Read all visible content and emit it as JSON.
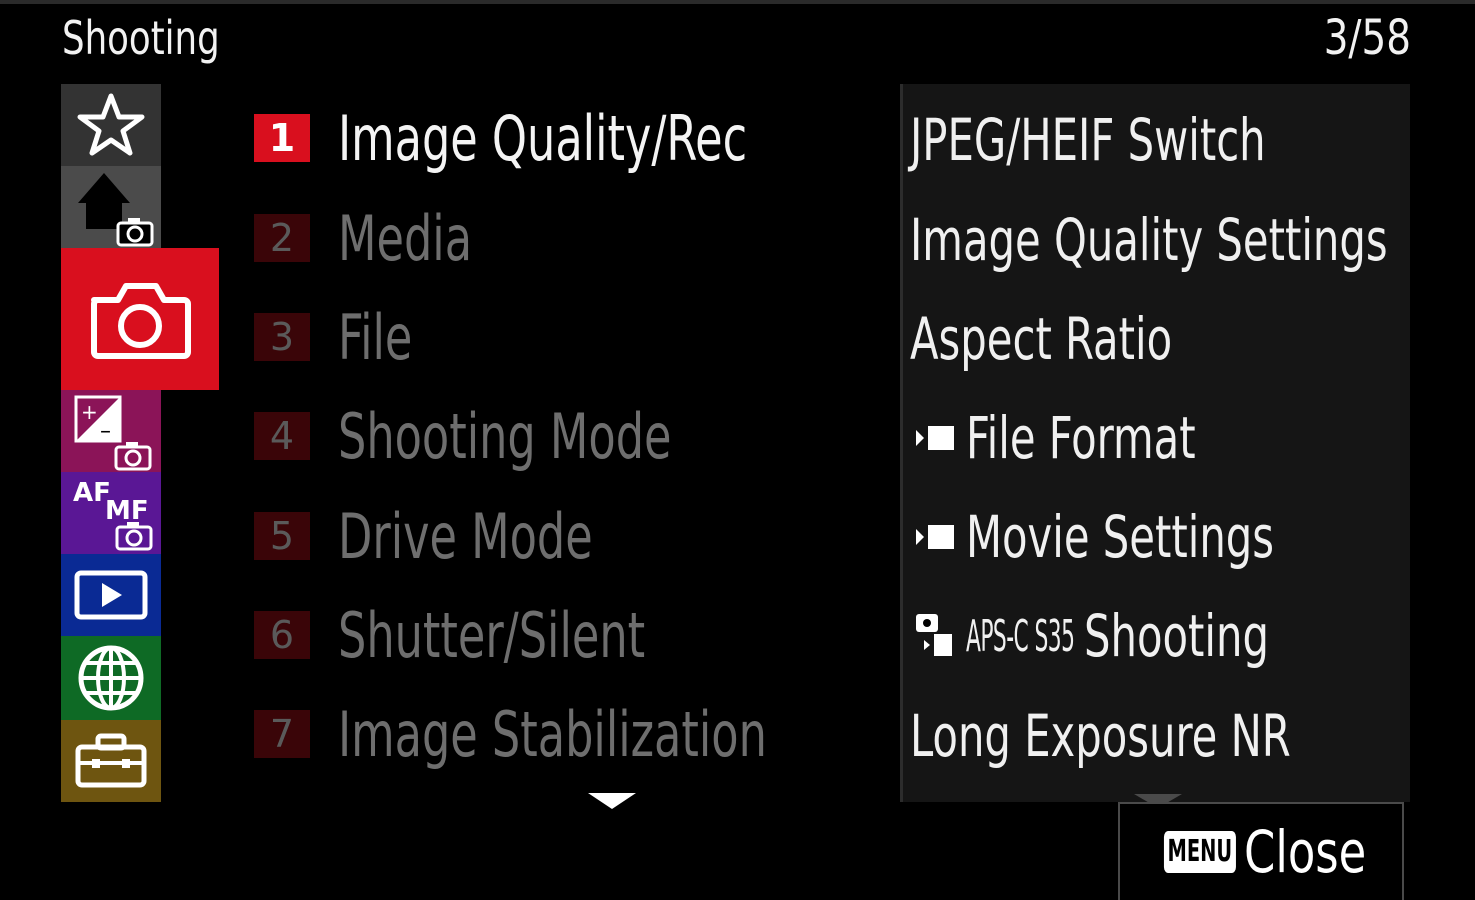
{
  "header": {
    "title": "Shooting",
    "page_counter": "3/58"
  },
  "sidebar": {
    "items": [
      {
        "name": "my-menu",
        "icon": "star-icon",
        "color": "#333333"
      },
      {
        "name": "main",
        "icon": "home-camera-icon",
        "color": "#4b4b4b"
      },
      {
        "name": "shooting",
        "icon": "camera-icon",
        "color": "#d90f1e",
        "selected": true
      },
      {
        "name": "exposure-color",
        "icon": "exposure-camera-icon",
        "color": "#8b1458"
      },
      {
        "name": "focus",
        "icon": "af-mf-camera-icon",
        "color": "#5a1795",
        "af": "AF",
        "mf": "MF"
      },
      {
        "name": "playback",
        "icon": "play-icon",
        "color": "#0a2a94"
      },
      {
        "name": "network",
        "icon": "globe-icon",
        "color": "#0e6a25"
      },
      {
        "name": "setup",
        "icon": "toolbox-icon",
        "color": "#6e5510"
      }
    ]
  },
  "submenu": {
    "items": [
      {
        "num": "1",
        "label": "Image Quality/Rec",
        "active": true
      },
      {
        "num": "2",
        "label": "Media"
      },
      {
        "num": "3",
        "label": "File"
      },
      {
        "num": "4",
        "label": "Shooting Mode"
      },
      {
        "num": "5",
        "label": "Drive Mode"
      },
      {
        "num": "6",
        "label": "Shutter/Silent"
      },
      {
        "num": "7",
        "label": "Image Stabilization"
      }
    ],
    "more_icon": "down-arrow-icon"
  },
  "settings": {
    "items": [
      {
        "label": "JPEG/HEIF Switch"
      },
      {
        "label": "Image Quality Settings"
      },
      {
        "label": "Aspect Ratio"
      },
      {
        "label": "File Format",
        "icon": "movie-icon"
      },
      {
        "label": "Movie Settings",
        "icon": "movie-icon"
      },
      {
        "label": "Shooting",
        "icon": "still-movie-icon",
        "prefix": "APS-C S35"
      },
      {
        "label": "Long Exposure NR"
      }
    ]
  },
  "footer": {
    "menu_badge": "MENU",
    "close_label": "Close"
  },
  "colors": {
    "accent": "#d90f1e",
    "background": "#000000"
  }
}
